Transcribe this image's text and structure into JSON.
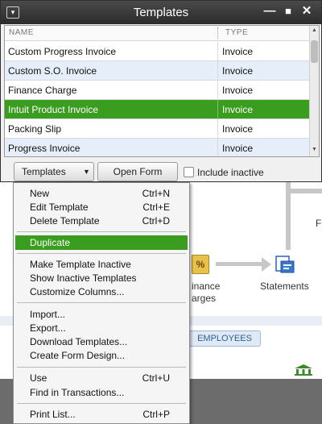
{
  "window": {
    "title": "Templates",
    "menu_glyph": "▾",
    "minimize": "—",
    "maximize": "■",
    "close": "✕"
  },
  "list": {
    "headers": {
      "name": "NAME",
      "type": "TYPE"
    },
    "rows": [
      {
        "name": "Custom Progress Invoice",
        "type": "Invoice"
      },
      {
        "name": "Custom S.O. Invoice",
        "type": "Invoice"
      },
      {
        "name": "Finance Charge",
        "type": "Invoice"
      },
      {
        "name": "Intuit Product Invoice",
        "type": "Invoice",
        "selected": true
      },
      {
        "name": "Packing Slip",
        "type": "Invoice"
      },
      {
        "name": "Progress Invoice",
        "type": "Invoice"
      }
    ],
    "scroll_up": "▲",
    "scroll_down": "▼"
  },
  "toolbar": {
    "templates_button": "Templates",
    "templates_caret": "▼",
    "open_form_button": "Open Form",
    "include_inactive": "Include inactive",
    "include_inactive_checked": false
  },
  "menu": {
    "items": [
      {
        "label": "New",
        "shortcut": "Ctrl+N"
      },
      {
        "label": "Edit Template",
        "shortcut": "Ctrl+E"
      },
      {
        "label": "Delete Template",
        "shortcut": "Ctrl+D"
      },
      {
        "label": "Duplicate",
        "shortcut": "",
        "highlighted": true
      },
      {
        "label": "Make Template Inactive",
        "shortcut": ""
      },
      {
        "label": "Show Inactive Templates",
        "shortcut": ""
      },
      {
        "label": "Customize Columns...",
        "shortcut": ""
      },
      {
        "label": "Import...",
        "shortcut": ""
      },
      {
        "label": "Export...",
        "shortcut": ""
      },
      {
        "label": "Download Templates...",
        "shortcut": ""
      },
      {
        "label": "Create Form Design...",
        "shortcut": ""
      },
      {
        "label": "Use",
        "shortcut": "Ctrl+U"
      },
      {
        "label": "Find in Transactions...",
        "shortcut": ""
      },
      {
        "label": "Print List...",
        "shortcut": "Ctrl+P"
      }
    ]
  },
  "background": {
    "finance_charges_label": "inance\narges",
    "finance_icon_glyph": "%",
    "statements_label": "Statements",
    "employees_tab": "EMPLOYEES",
    "partial_label": "F"
  },
  "colors": {
    "selection": "#3b9d1f",
    "row_alt": "#e5eef9",
    "titlebar": "#2b2b2b"
  }
}
